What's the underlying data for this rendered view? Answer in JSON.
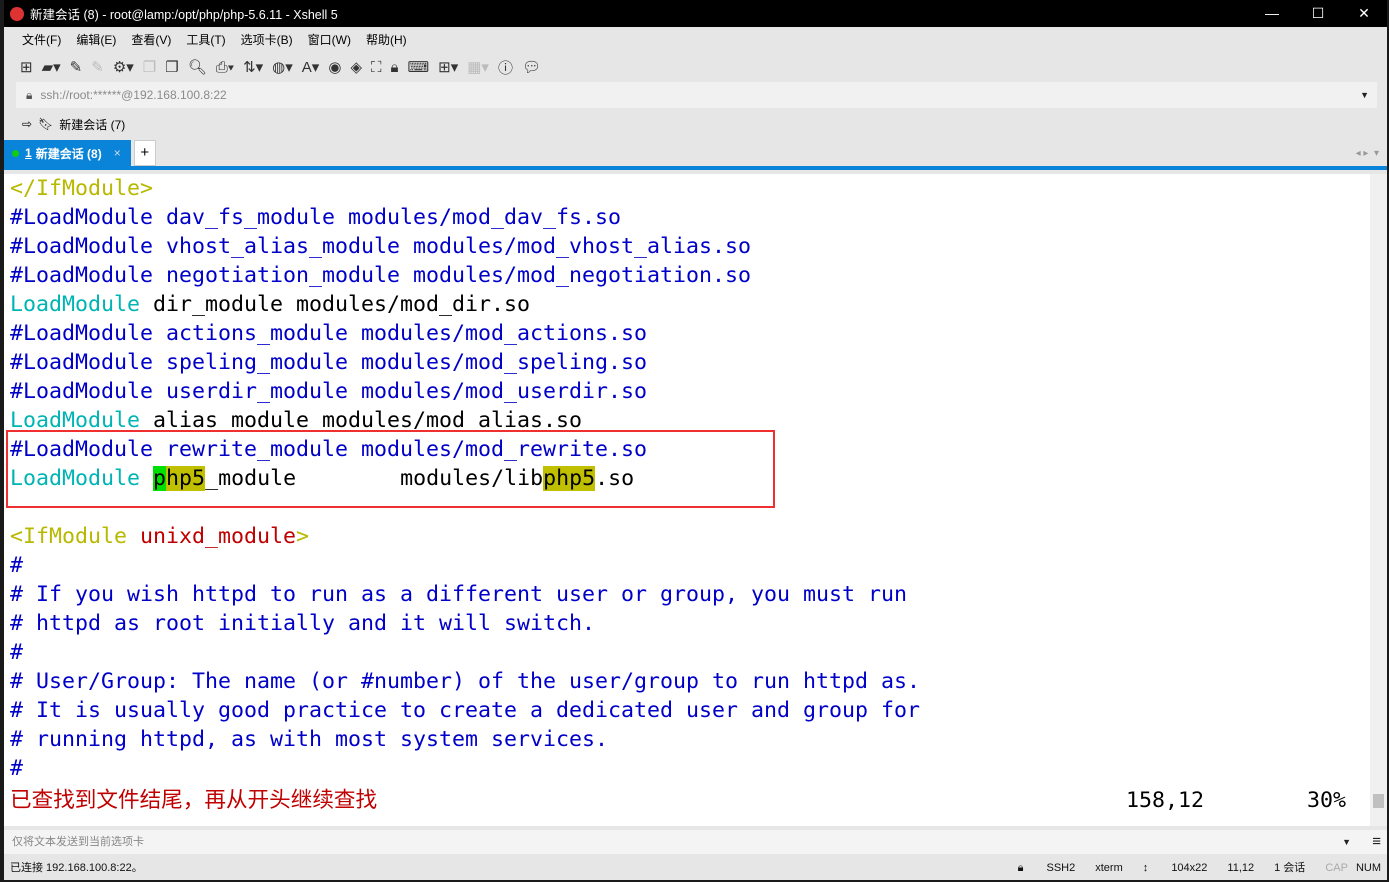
{
  "window": {
    "title": "新建会话 (8) - root@lamp:/opt/php/php-5.6.11 - Xshell 5",
    "controls": [
      "—",
      "☐",
      "✕"
    ]
  },
  "menu": [
    "文件(F)",
    "编辑(E)",
    "查看(V)",
    "工具(T)",
    "选项卡(B)",
    "窗口(W)",
    "帮助(H)"
  ],
  "toolbar_icons": [
    "new-session-icon",
    "open-folder-icon",
    "connect-icon",
    "disconnect-icon",
    "properties-icon",
    "copy-icon",
    "paste-icon",
    "find-icon",
    "print-icon",
    "transfer-icon",
    "globe-icon",
    "font-icon",
    "xftp-icon",
    "xmanager-icon",
    "fullscreen-icon",
    "lock-icon",
    "keyboard-icon",
    "new-tab-icon",
    "layout-icon",
    "help-icon",
    "chat-icon"
  ],
  "address": {
    "value": "ssh://root:******@192.168.100.8:22"
  },
  "session_bar": {
    "label": "新建会话 (7)"
  },
  "tabs": [
    {
      "number": "1",
      "label": "新建会话 (8)",
      "close": "×"
    }
  ],
  "tab_add": "+",
  "terminal": {
    "lines": [
      [
        [
          "y",
          "</IfModule>"
        ]
      ],
      [
        [
          "c",
          "#LoadModule dav_fs_module modules/mod_dav_fs.so"
        ]
      ],
      [
        [
          "c",
          "#LoadModule vhost_alias_module modules/mod_vhost_alias.so"
        ]
      ],
      [
        [
          "c",
          "#LoadModule negotiation_module modules/mod_negotiation.so"
        ]
      ],
      [
        [
          "k",
          "LoadModule"
        ],
        [
          "t",
          " dir_module modules/mod_dir.so"
        ]
      ],
      [
        [
          "c",
          "#LoadModule actions_module modules/mod_actions.so"
        ]
      ],
      [
        [
          "c",
          "#LoadModule speling_module modules/mod_speling.so"
        ]
      ],
      [
        [
          "c",
          "#LoadModule userdir_module modules/mod_userdir.so"
        ]
      ],
      [
        [
          "k",
          "LoadModule"
        ],
        [
          "t",
          " alias_module modules/mod_alias.so"
        ]
      ],
      [
        [
          "c",
          "#LoadModule rewrite_module modules/mod_rewrite.so"
        ]
      ],
      [
        [
          "k",
          "LoadModule"
        ],
        [
          "t",
          " "
        ],
        [
          "hg",
          "p"
        ],
        [
          "hy",
          "hp5"
        ],
        [
          "t",
          "_module        modules/lib"
        ],
        [
          "hy",
          "php5"
        ],
        [
          "t",
          ".so"
        ]
      ],
      [
        [
          "t",
          ""
        ]
      ],
      [
        [
          "y",
          "<IfModule"
        ],
        [
          "t",
          " "
        ],
        [
          "r",
          "unixd_module"
        ],
        [
          "y",
          ">"
        ]
      ],
      [
        [
          "c",
          "#"
        ]
      ],
      [
        [
          "c",
          "# If you wish httpd to run as a different user or group, you must run"
        ]
      ],
      [
        [
          "c",
          "# httpd as root initially and it will switch."
        ]
      ],
      [
        [
          "c",
          "#"
        ]
      ],
      [
        [
          "c",
          "# User/Group: The name (or #number) of the user/group to run httpd as."
        ]
      ],
      [
        [
          "c",
          "# It is usually good practice to create a dedicated user and group for"
        ]
      ],
      [
        [
          "c",
          "# running httpd, as with most system services."
        ]
      ],
      [
        [
          "c",
          "#"
        ]
      ]
    ],
    "status_message": "已查找到文件结尾，再从开头继续查找",
    "cursor_position": "158,12",
    "scroll_percent": "30%"
  },
  "send_bar": {
    "placeholder": "仅将文本发送到当前选项卡"
  },
  "statusbar": {
    "connection": "已连接 192.168.100.8:22。",
    "protocol": "SSH2",
    "terminal": "xterm",
    "size": "104x22",
    "cursor": "11,12",
    "sessions": "1 会话",
    "caps": "CAP",
    "num": "NUM"
  },
  "colors": {
    "accent": "#0a84d8",
    "comment": "#0000c8",
    "keyword": "#00b4b4",
    "highlight_box": "#f03030"
  }
}
